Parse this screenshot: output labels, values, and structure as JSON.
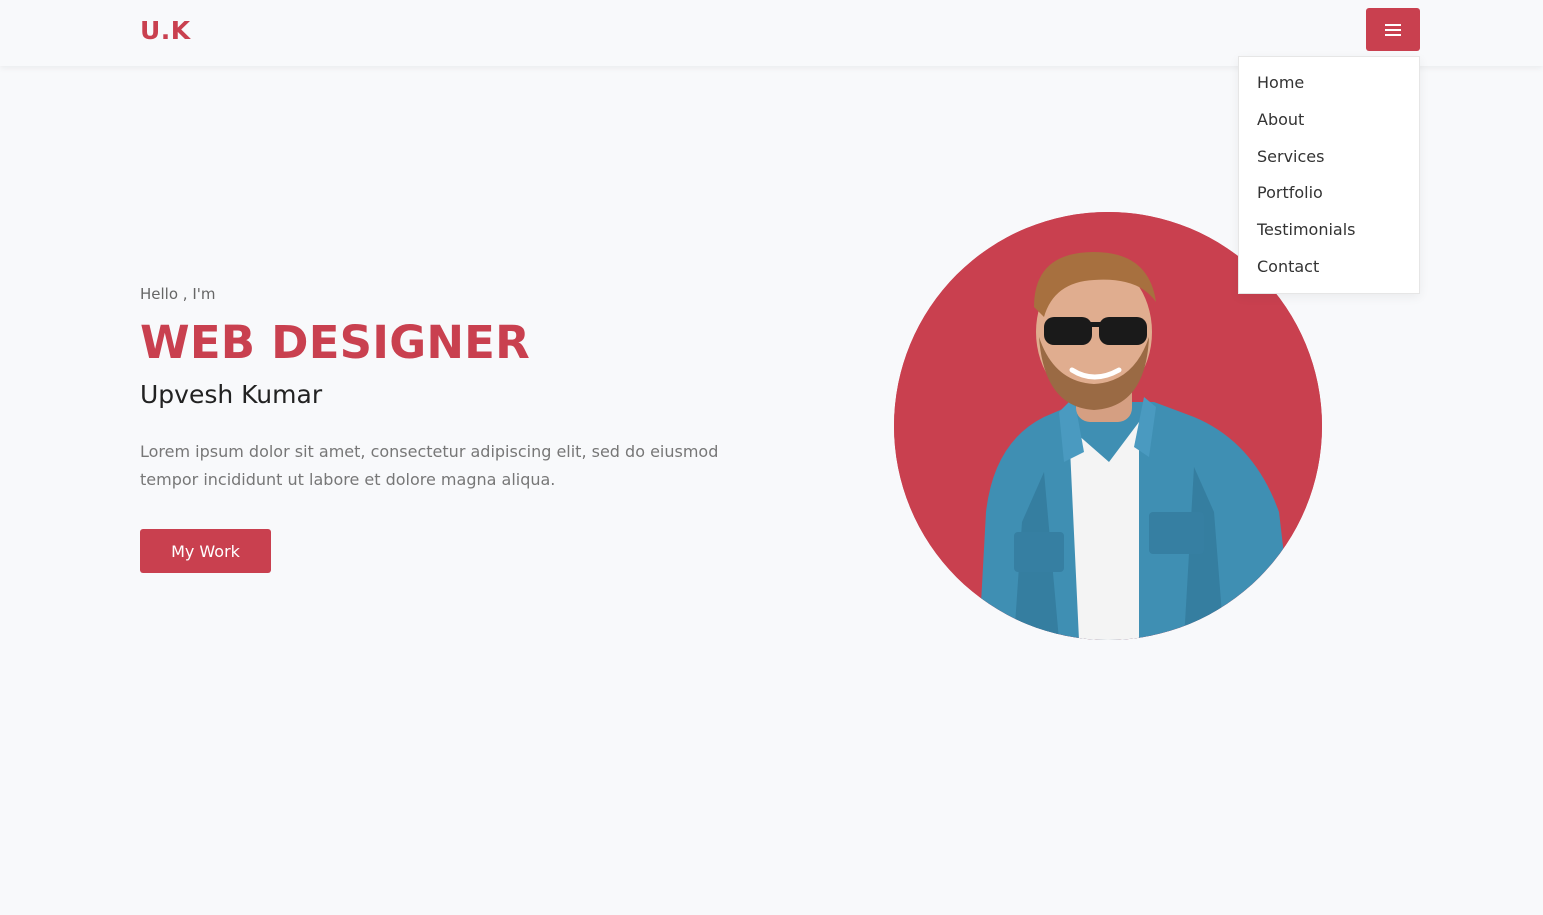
{
  "header": {
    "brand": "U.K",
    "menu_icon": "hamburger-icon"
  },
  "nav": {
    "items": [
      {
        "label": "Home"
      },
      {
        "label": "About"
      },
      {
        "label": "Services"
      },
      {
        "label": "Portfolio"
      },
      {
        "label": "Testimonials"
      },
      {
        "label": "Contact"
      }
    ]
  },
  "hero": {
    "greeting": "Hello , I'm",
    "title": "WEB DESIGNER",
    "name": "Upvesh Kumar",
    "description": "Lorem ipsum dolor sit amet, consectetur adipiscing elit, sed do eiusmod tempor incididunt ut labore et dolore magna aliqua.",
    "cta_label": "My Work"
  },
  "colors": {
    "accent": "#c9404f",
    "background": "#f8f9fb"
  }
}
